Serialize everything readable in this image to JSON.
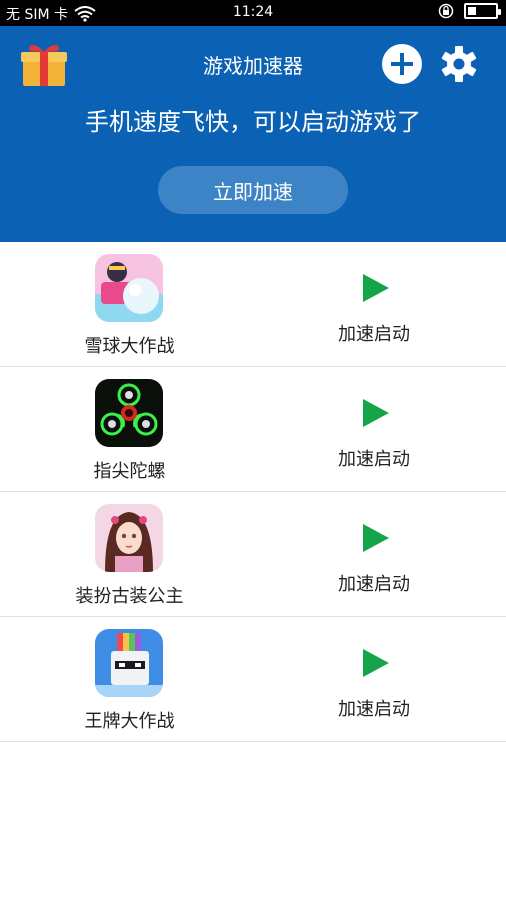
{
  "statusbar": {
    "carrier": "无 SIM 卡",
    "time": "11:24"
  },
  "header": {
    "title": "游戏加速器",
    "subtitle": "手机速度飞快，可以启动游戏了",
    "accelerate_label": "立即加速"
  },
  "games": [
    {
      "name": "雪球大作战",
      "action": "加速启动"
    },
    {
      "name": "指尖陀螺",
      "action": "加速启动"
    },
    {
      "name": "装扮古装公主",
      "action": "加速启动"
    },
    {
      "name": "王牌大作战",
      "action": "加速启动"
    }
  ],
  "colors": {
    "header_bg": "#0b61b3",
    "button_bg": "#3c84c6",
    "play_green": "#15a44a"
  }
}
